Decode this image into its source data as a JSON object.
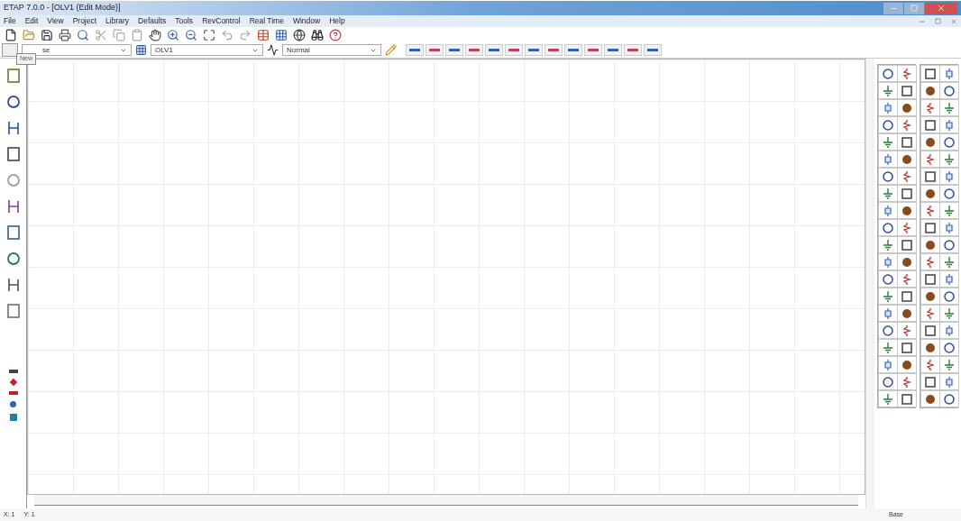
{
  "window": {
    "title": "ETAP 7.0.0 - [OLV1 (Edit Mode)]"
  },
  "menu": [
    "File",
    "Edit",
    "View",
    "Project",
    "Library",
    "Defaults",
    "Tools",
    "RevControl",
    "Real Time",
    "Window",
    "Help"
  ],
  "toolbar": {
    "combos": [
      {
        "value": "se"
      },
      {
        "value": "OLV1"
      },
      {
        "value": "Normal"
      }
    ],
    "tooltip": "New"
  },
  "status_bar": {
    "x": "X: 1",
    "y": "Y: 1",
    "presentation": "Base"
  }
}
